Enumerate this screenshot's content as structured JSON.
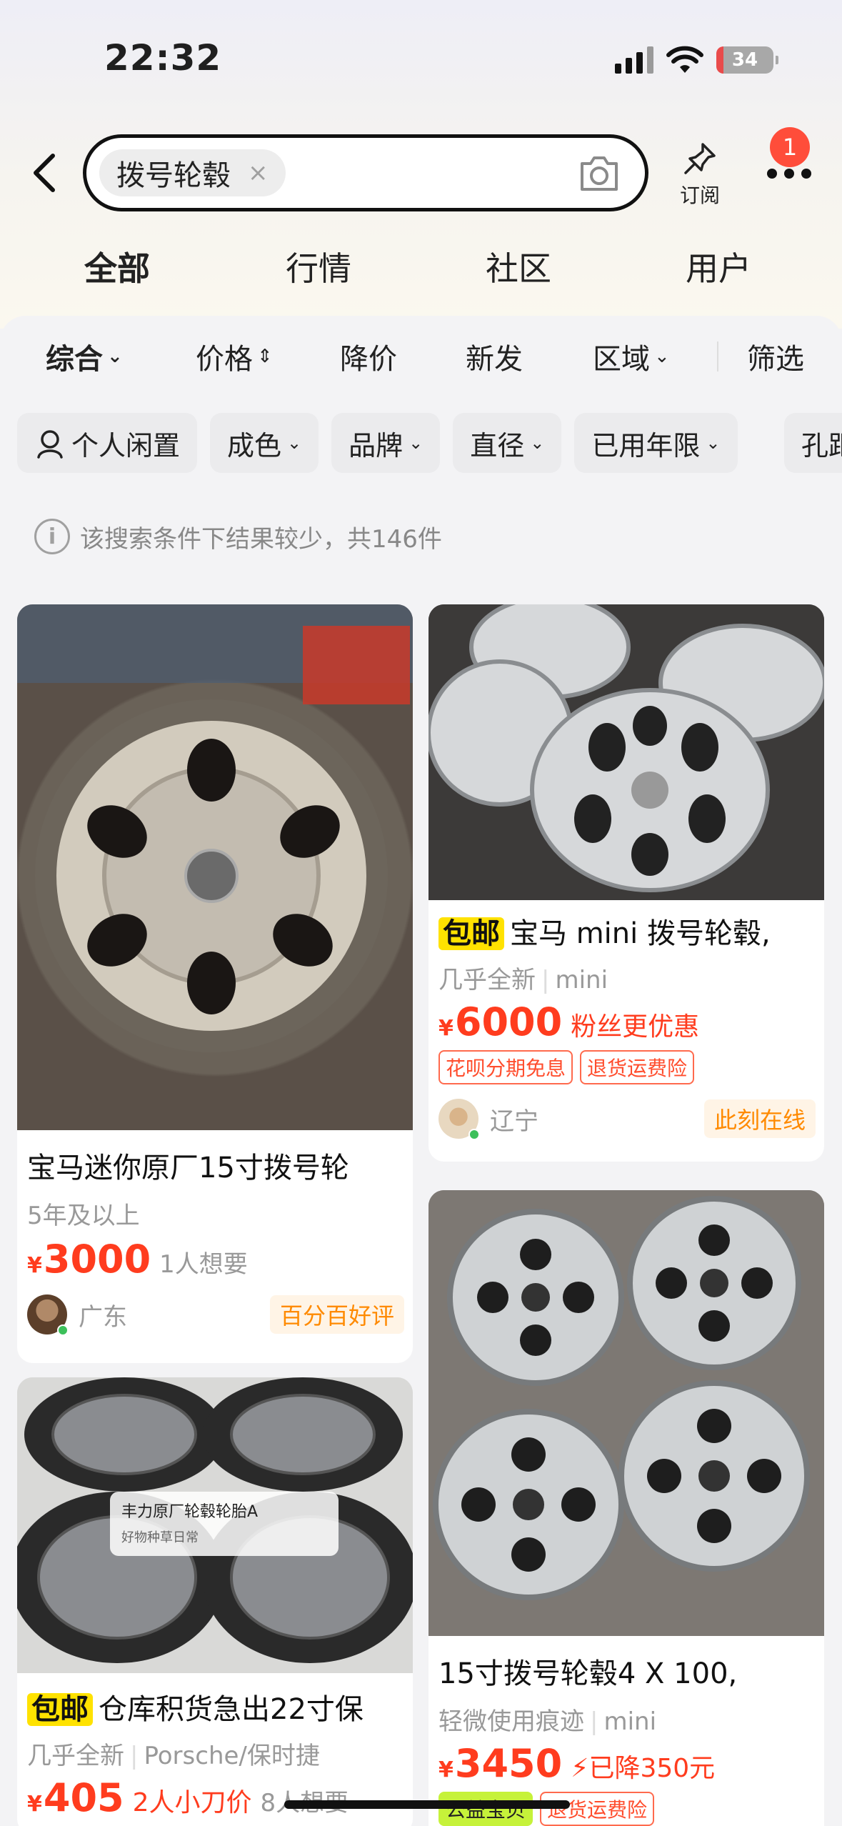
{
  "status": {
    "time": "22:32",
    "battery": "34"
  },
  "search": {
    "query_chip": "拨号轮毂",
    "clear_icon": "×",
    "subscribe_label": "订阅",
    "notification_count": "1"
  },
  "tabs": [
    {
      "label": "全部",
      "active": true
    },
    {
      "label": "行情",
      "active": false
    },
    {
      "label": "社区",
      "active": false
    },
    {
      "label": "用户",
      "active": false
    }
  ],
  "sort": {
    "comprehensive": "综合",
    "price": "价格",
    "price_drop": "降价",
    "new": "新发",
    "region": "区域",
    "filter": "筛选"
  },
  "filters": [
    "个人闲置",
    "成色",
    "品牌",
    "直径",
    "已用年限",
    "孔距"
  ],
  "notice": "该搜索条件下结果较少，共146件",
  "products": [
    {
      "title": "宝马迷你原厂15寸拨号轮",
      "tags": [
        "5年及以上"
      ],
      "price_symbol": "¥",
      "price": "3000",
      "want": "1人想要",
      "location": "广东",
      "seller_badge": "百分百好评"
    },
    {
      "baoyou": "包邮",
      "title": "宝马 mini 拨号轮毂,",
      "tags": [
        "几乎全新",
        "mini"
      ],
      "price_symbol": "¥",
      "price": "6000",
      "extra": "粉丝更优惠",
      "promos": [
        "花呗分期免息",
        "退货运费险"
      ],
      "location": "辽宁",
      "seller_badge": "此刻在线"
    },
    {
      "baoyou": "包邮",
      "title": "仓库积货急出22寸保",
      "tags": [
        "几乎全新",
        "Porsche/保时捷"
      ],
      "price_symbol": "¥",
      "price": "405",
      "extra": "2人小刀价",
      "want": "8人想要",
      "overlay_title": "丰力原厂轮毂轮胎A",
      "overlay_sub": "好物种草日常"
    },
    {
      "title": "15寸拨号轮毂4 X 100,",
      "tags": [
        "轻微使用痕迹",
        "mini"
      ],
      "price_symbol": "¥",
      "price": "3450",
      "extra": "已降350元",
      "promos": [
        "公益宝贝",
        "退货运费险"
      ]
    }
  ],
  "colors": {
    "accent": "#ffe200",
    "price": "#ff3c1e",
    "badge": "#ff4d3a"
  }
}
